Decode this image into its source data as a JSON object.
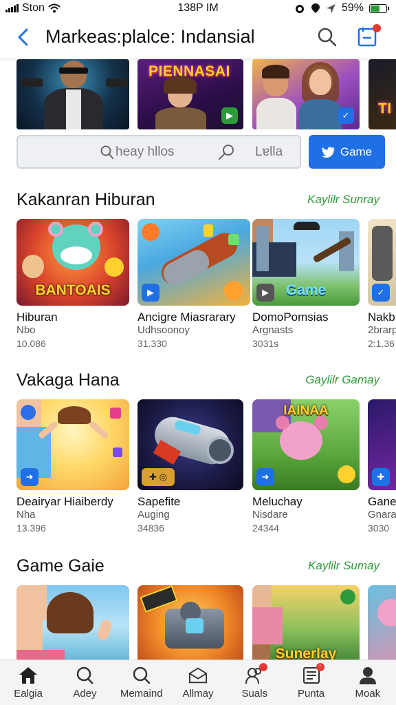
{
  "status_bar": {
    "carrier": "Ston",
    "time": "138P IM",
    "battery": "59%",
    "battery_level": 0.59
  },
  "app_bar": {
    "title": "Markeas:plalce: Indansial"
  },
  "banners": [
    {
      "title": ""
    },
    {
      "title": "PIENNASAI"
    },
    {
      "title": ""
    },
    {
      "title": "TI"
    }
  ],
  "search": {
    "placeholder": "heay hllos",
    "help_text": "Lɐlla",
    "game_button": "Game"
  },
  "sections": [
    {
      "title": "Kakanran Hiburan",
      "link": "Kaylilr Sunray",
      "cards": [
        {
          "art_title": "BANTOAIS",
          "name": "Hiburan",
          "sub": "Nbo",
          "count": "10.086"
        },
        {
          "art_title": "",
          "name": "Ancigre Miasrarary",
          "sub": "Udhsoonoy",
          "count": "31.330"
        },
        {
          "art_title": "Game",
          "name": "DomoPomsias",
          "sub": "Argnasts",
          "count": "3031s"
        },
        {
          "art_title": "",
          "name": "Nakb",
          "sub": "2brarp",
          "count": "2:1.36"
        }
      ]
    },
    {
      "title": "Vakaga Hana",
      "link": "Gaylilr Gamay",
      "cards": [
        {
          "art_title": "",
          "name": "Deairyar Hiaiberdy",
          "sub": "Nha",
          "count": "13.396"
        },
        {
          "art_title": "",
          "name": "Sapefite",
          "sub": "Auging",
          "count": "34836"
        },
        {
          "art_title": "IAINAA",
          "name": "Meluchay",
          "sub": "Nisdare",
          "count": "24344"
        },
        {
          "art_title": "",
          "name": "Gane",
          "sub": "Gnara",
          "count": "3030"
        }
      ]
    },
    {
      "title": "Game Gaie",
      "link": "Kaylilr Sumay",
      "cards": [
        {
          "art_title": ""
        },
        {
          "art_title": ""
        },
        {
          "art_title": "Sunerlay"
        },
        {
          "art_title": ""
        }
      ]
    }
  ],
  "bottom_nav": [
    {
      "label": "Ealgia",
      "icon": "home-icon",
      "active": true
    },
    {
      "label": "Adey",
      "icon": "search-icon"
    },
    {
      "label": "Memaind",
      "icon": "search-icon"
    },
    {
      "label": "Allmay",
      "icon": "mail-icon"
    },
    {
      "label": "Suals",
      "icon": "people-icon",
      "badge": true
    },
    {
      "label": "Punta",
      "icon": "news-icon",
      "badge": true
    },
    {
      "label": "Moak",
      "icon": "profile-icon"
    }
  ],
  "colors": {
    "accent": "#1f6fe5",
    "link": "#2e9b3a",
    "badge": "#e53935"
  }
}
